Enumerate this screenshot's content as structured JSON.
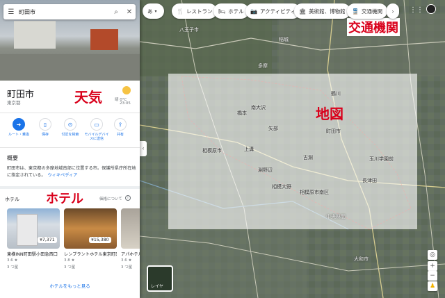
{
  "search": {
    "query": "町田市"
  },
  "place": {
    "title": "町田市",
    "subtitle": "東京都"
  },
  "weather": {
    "temp": "晴 0°C",
    "time": "23:05"
  },
  "actions": [
    {
      "label": "ルート・乗換",
      "icon": "directions-icon"
    },
    {
      "label": "保存",
      "icon": "bookmark-icon"
    },
    {
      "label": "付近を検索",
      "icon": "nearby-icon"
    },
    {
      "label": "モバイルデバイスに送信",
      "icon": "send-to-phone-icon"
    },
    {
      "label": "共有",
      "icon": "share-icon"
    }
  ],
  "overview": {
    "heading": "概要",
    "text": "町田市は、東京都の多摩地域南部に位置する市。保護所県庁所在地に指定されている。",
    "wiki": "ウィキペディア"
  },
  "hotels": {
    "heading": "ホテル",
    "price_label": "価格について",
    "items": [
      {
        "price": "¥7,371",
        "name": "東横INN町田駅小田急西口",
        "rating": "3.6 ★",
        "class": "3 つ星"
      },
      {
        "price": "¥15,380",
        "name": "レンブラントホテル東京町田",
        "rating": "3.8 ★",
        "class": "3 つ星"
      },
      {
        "price": "",
        "name": "アパホテル",
        "rating": "3.6 ★",
        "class": "3 つ星"
      }
    ],
    "more": "ホテルをもっと見る"
  },
  "chips": [
    {
      "label": "あ",
      "icon": ""
    },
    {
      "label": "レストラン",
      "icon": "restaurant-icon"
    },
    {
      "label": "ホテル",
      "icon": "hotel-icon"
    },
    {
      "label": "アクティビティ",
      "icon": "camera-icon"
    },
    {
      "label": "美術館、博物館",
      "icon": "museum-icon"
    },
    {
      "label": "交通機関",
      "icon": "transit-icon"
    }
  ],
  "callouts": {
    "weather": "天気",
    "map": "地図",
    "hotel": "ホテル",
    "transit": "交通機関"
  },
  "map_labels": [
    "八王子市",
    "相模原市",
    "町田市",
    "稲城",
    "多摩",
    "南大沢",
    "相模大野",
    "中央林間",
    "大和市",
    "長津田",
    "橋本",
    "上溝",
    "矢部",
    "古淵",
    "淵野辺",
    "玉川学園前",
    "鶴川",
    "相模原市南区",
    "レイヤ"
  ],
  "layers_label": "レイヤ",
  "colors": {
    "callout": "#d9001b",
    "accent": "#1a73e8",
    "star": "#f4b400"
  }
}
